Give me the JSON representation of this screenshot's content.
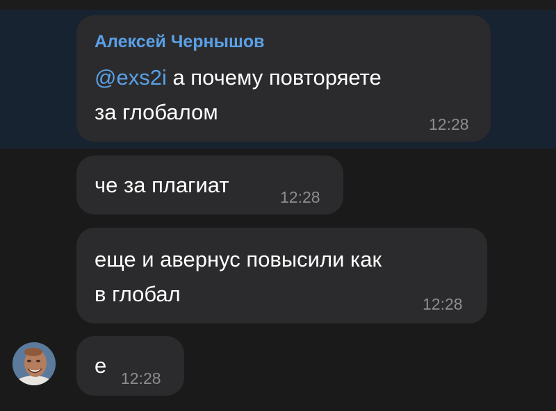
{
  "messages": [
    {
      "sender": "Алексей Чернышов",
      "mention": "@exs2i",
      "line1_rest": " а почему повторяете",
      "line2": "за глобалом",
      "time": "12:28"
    },
    {
      "line1": "че за плагиат",
      "time": "12:28"
    },
    {
      "line1": "еще и авернус повысили как",
      "line2": "в глобал",
      "time": "12:28"
    },
    {
      "line1": "е",
      "time": "12:28"
    }
  ],
  "colors": {
    "background": "#1a1a1a",
    "highlight": "#182331",
    "bubble": "#2b2b2d",
    "accent": "#5aa0e6",
    "time": "#8d8d8f"
  }
}
